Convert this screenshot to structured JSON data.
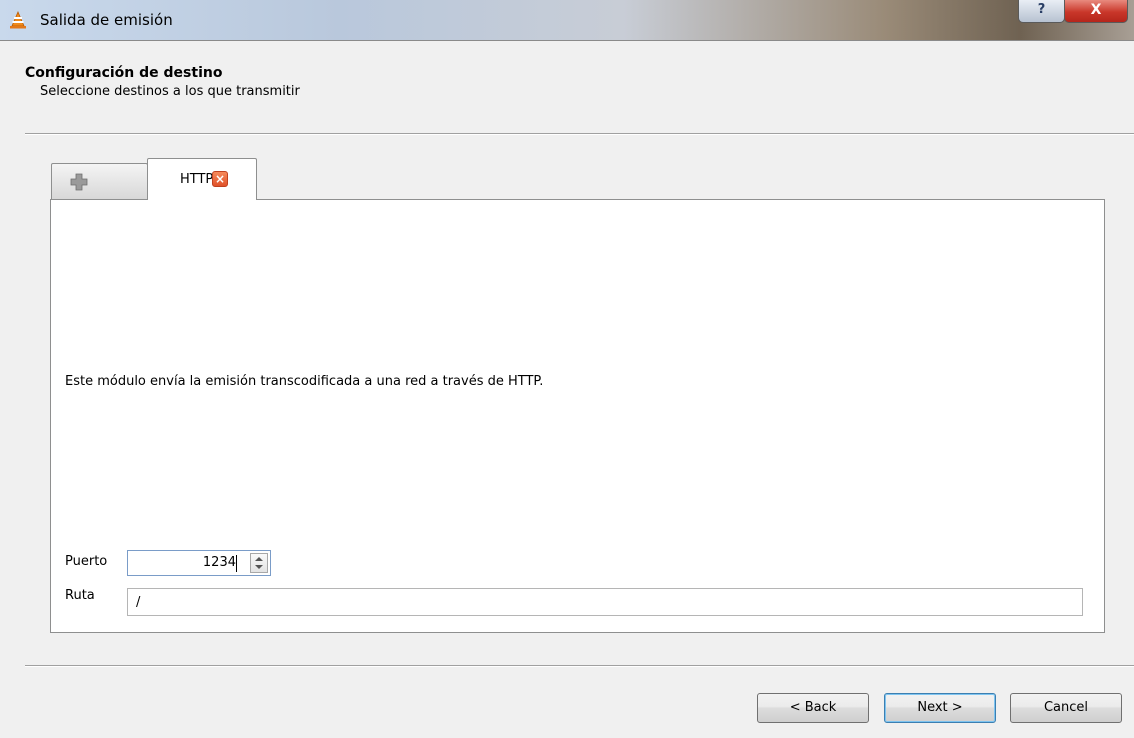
{
  "window": {
    "title": "Salida de emisión",
    "help_label": "?",
    "close_label": "X"
  },
  "header": {
    "title": "Configuración de destino",
    "subtitle": "Seleccione destinos a los que transmitir"
  },
  "tabs": [
    {
      "label": "",
      "icon": "plus-icon"
    },
    {
      "label": "HTTP",
      "close_label": "×"
    }
  ],
  "panel": {
    "description": "Este módulo envía la emisión transcodificada a una red a través de HTTP.",
    "port_label": "Puerto",
    "port_value": "1234",
    "path_label": "Ruta",
    "path_value": "/"
  },
  "buttons": {
    "back": "< Back",
    "next": "Next >",
    "cancel": "Cancel"
  }
}
